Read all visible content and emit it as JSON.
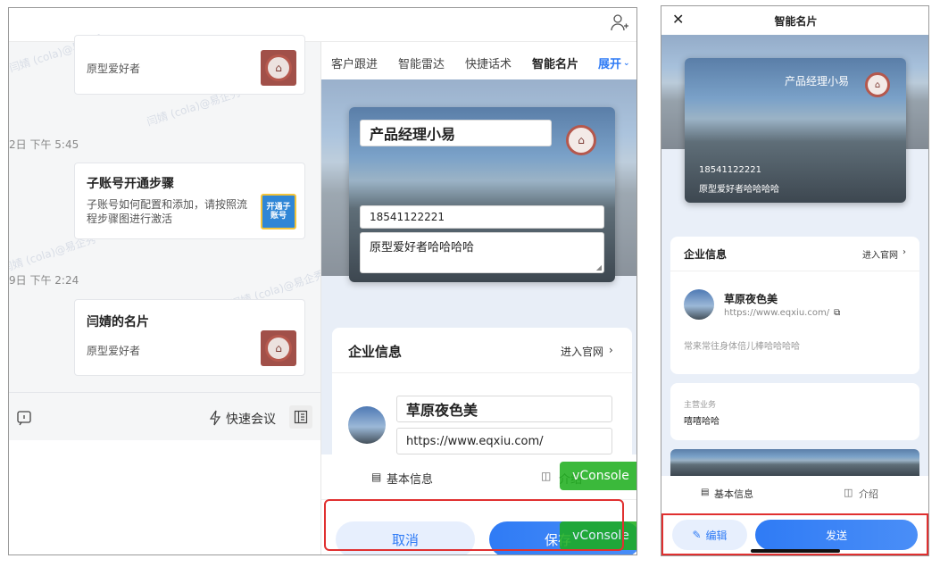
{
  "chat": {
    "watermark": "闫婧 (cola)@易企秀",
    "top_card": {
      "subtitle": "原型爱好者"
    },
    "time1": "2日 下午 5:45",
    "card2": {
      "title": "子账号开通步骤",
      "desc": "子账号如何配置和添加，请按照流程步骤图进行激活",
      "thumb_text": "开通子账号"
    },
    "time2": "9日 下午 2:24",
    "card3": {
      "title": "闫婧的名片",
      "subtitle": "原型爱好者"
    },
    "quick_meeting": "快速会议"
  },
  "tabs": [
    "客户跟进",
    "智能雷达",
    "快捷话术",
    "智能名片"
  ],
  "tab_expand": "展开",
  "edit_card": {
    "title_value": "产品经理小易",
    "phone_value": "18541122221",
    "bio_value": "原型爱好者哈哈哈哈"
  },
  "enterprise_left": {
    "title": "企业信息",
    "link": "进入官网",
    "name_value": "草原夜色美",
    "url_value": "https://www.eqxiu.com/"
  },
  "bottom_tabs_left": {
    "basic": "基本信息",
    "intro": "介绍"
  },
  "vconsole": "vConsole",
  "actions_left": {
    "cancel": "取消",
    "save": "保存"
  },
  "right": {
    "title": "智能名片",
    "card": {
      "name": "产品经理小易",
      "phone": "18541122221",
      "bio": "原型爱好者哈哈哈哈"
    },
    "enterprise": {
      "title": "企业信息",
      "link": "进入官网",
      "name": "草原夜色美",
      "url": "https://www.eqxiu.com/",
      "desc": "常来常往身体倍儿棒哈哈哈哈"
    },
    "business": {
      "label": "主营业务",
      "value": "嘻嘻哈哈"
    },
    "bottom_tabs": {
      "basic": "基本信息",
      "intro": "介绍"
    },
    "actions": {
      "edit": "编辑",
      "send": "发送"
    }
  },
  "colors": {
    "accent": "#2f7bf5",
    "highlight": "#e03030"
  }
}
